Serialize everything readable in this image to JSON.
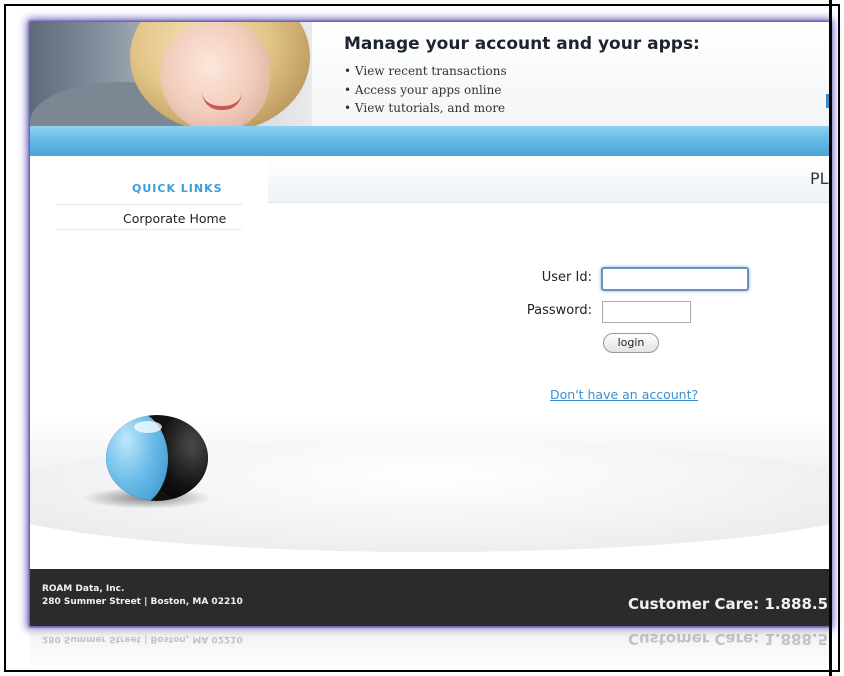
{
  "header": {
    "headline": "Manage your account and your apps:",
    "bullets": [
      "View recent transactions",
      "Access your apps online",
      "View tutorials, and more"
    ]
  },
  "nav": {
    "quick_links_title": "QUICK LINKS",
    "items": [
      "Corporate Home"
    ],
    "page_title_partial": "PLE"
  },
  "login": {
    "user_label": "User Id:",
    "password_label": "Password:",
    "user_value": "",
    "password_value": "",
    "button_label": "login",
    "signup_link": "Don't have an account?"
  },
  "footer": {
    "company": "ROAM Data, Inc.",
    "address": "280 Summer Street | Boston, MA 02210",
    "customer_care": "Customer Care: 1.888.5"
  },
  "colors": {
    "accent_blue": "#5fb7e6",
    "link_blue": "#3a8fd0",
    "footer_bg": "#2c2b2a"
  }
}
